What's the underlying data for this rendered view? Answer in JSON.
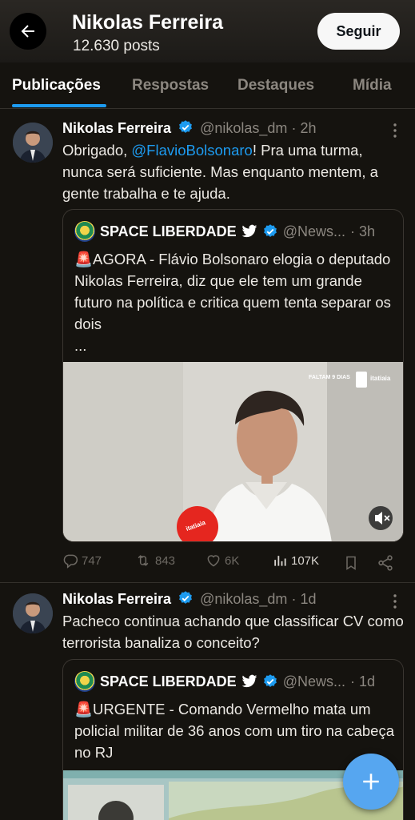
{
  "header": {
    "title": "Nikolas Ferreira",
    "post_count": "12.630 posts",
    "follow_label": "Seguir"
  },
  "tabs": [
    {
      "label": "Publicações",
      "active": true
    },
    {
      "label": "Respostas",
      "active": false
    },
    {
      "label": "Destaques",
      "active": false
    },
    {
      "label": "Mídia",
      "active": false
    }
  ],
  "posts": [
    {
      "author_name": "Nikolas Ferreira",
      "handle": "@nikolas_dm",
      "time": "· 2h",
      "text_before": "Obrigado, ",
      "mention": "@FlavioBolsonaro",
      "text_after": "! Pra uma turma, nunca será suficiente. Mas enquanto mentem, a gente trabalha e te ajuda.",
      "quote": {
        "name": "SPACE LIBERDADE",
        "handle": "@News...",
        "time": "· 3h",
        "text": "🚨AGORA - Flávio Bolsonaro elogia o deputado Nikolas Ferreira, diz que ele tem um grande futuro na política e critica quem tenta separar os dois",
        "ellipsis": "...",
        "media_overlay": "FALTAM 9 DIAS",
        "media_brand": "itatiaia",
        "mic_brand": "itatiaia"
      },
      "stats": {
        "replies": "747",
        "reposts": "843",
        "likes": "6K",
        "views": "107K"
      }
    },
    {
      "author_name": "Nikolas Ferreira",
      "handle": "@nikolas_dm",
      "time": "· 1d",
      "text": "Pacheco continua achando que classificar CV como terrorista banaliza o conceito?",
      "quote": {
        "name": "SPACE LIBERDADE",
        "handle": "@News...",
        "time": "· 1d",
        "text": "🚨URGENTE - Comando Vermelho mata um policial militar de 36 anos com um tiro na cabeça no RJ"
      }
    }
  ],
  "colors": {
    "background": "#15130f",
    "accent": "#1d9bf0",
    "muted_text": "#8c8780",
    "fab": "#56a6f0"
  }
}
